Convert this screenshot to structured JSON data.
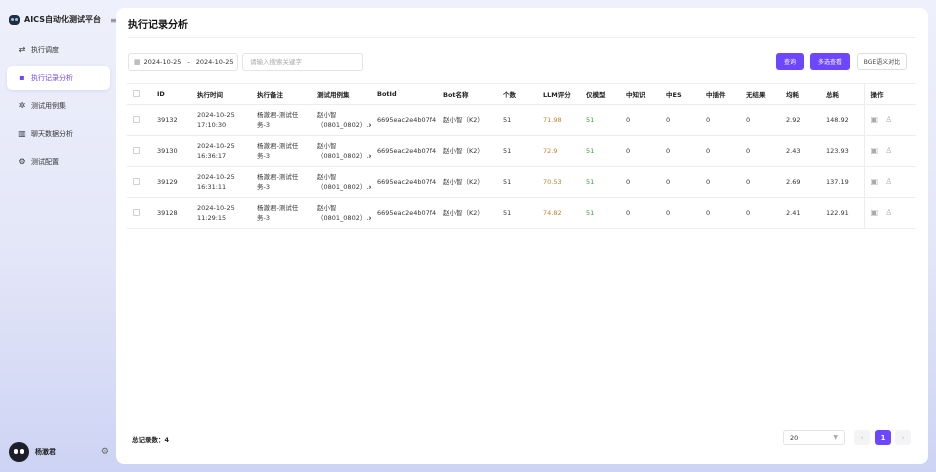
{
  "app": {
    "name": "AICS自动化测试平台"
  },
  "sidebar": {
    "items": [
      {
        "label": "执行调度",
        "icon": "swap-icon",
        "active": false
      },
      {
        "label": "执行记录分析",
        "icon": "chat-icon",
        "active": true
      },
      {
        "label": "测试用例集",
        "icon": "gear-icon",
        "active": false
      },
      {
        "label": "聊天数据分析",
        "icon": "bar-chart-icon",
        "active": false
      },
      {
        "label": "测试配置",
        "icon": "settings-icon",
        "active": false
      }
    ],
    "user": {
      "name": "杨澈君"
    }
  },
  "page": {
    "title": "执行记录分析"
  },
  "filters": {
    "date_start": "2024-10-25",
    "date_sep": "-",
    "date_end": "2024-10-25",
    "search_placeholder": "请输入搜索关键字"
  },
  "toolbar": {
    "query_label": "查询",
    "multi_label": "多选查看",
    "bge_label": "BGE语义对比"
  },
  "table": {
    "columns": [
      "ID",
      "执行时间",
      "执行备注",
      "测试用例集",
      "BotId",
      "Bot名称",
      "个数",
      "LLM评分",
      "仅模型",
      "中知识",
      "中ES",
      "中插件",
      "无结果",
      "均耗",
      "总耗",
      "操作"
    ],
    "rows": [
      {
        "id": "39132",
        "time1": "2024-10-25",
        "time2": "17:10:30",
        "note1": "杨澈君-测试任",
        "note2": "务-3",
        "case1": "赵小智",
        "case2": "（0801_0802）.xl",
        "botid": "6695eac2e4b07f41.",
        "botname": "赵小智（K2）",
        "count": "51",
        "llm": "71.98",
        "model": "51",
        "kb": "0",
        "es": "0",
        "plugin": "0",
        "none": "0",
        "avg": "2.92",
        "total": "148.92"
      },
      {
        "id": "39130",
        "time1": "2024-10-25",
        "time2": "16:36:17",
        "note1": "杨澈君-测试任",
        "note2": "务-3",
        "case1": "赵小智",
        "case2": "（0801_0802）.xl",
        "botid": "6695eac2e4b07f41.",
        "botname": "赵小智（K2）",
        "count": "51",
        "llm": "72.9",
        "model": "51",
        "kb": "0",
        "es": "0",
        "plugin": "0",
        "none": "0",
        "avg": "2.43",
        "total": "123.93"
      },
      {
        "id": "39129",
        "time1": "2024-10-25",
        "time2": "16:31:11",
        "note1": "杨澈君-测试任",
        "note2": "务-3",
        "case1": "赵小智",
        "case2": "（0801_0802）.xl",
        "botid": "6695eac2e4b07f41.",
        "botname": "赵小智（K2）",
        "count": "51",
        "llm": "70.53",
        "model": "51",
        "kb": "0",
        "es": "0",
        "plugin": "0",
        "none": "0",
        "avg": "2.69",
        "total": "137.19"
      },
      {
        "id": "39128",
        "time1": "2024-10-25",
        "time2": "11:29:15",
        "note1": "杨澈君-测试任",
        "note2": "务-3",
        "case1": "赵小智",
        "case2": "（0801_0802）.xl",
        "botid": "6695eac2e4b07f41.",
        "botname": "赵小智（K2）",
        "count": "51",
        "llm": "74.82",
        "model": "51",
        "kb": "0",
        "es": "0",
        "plugin": "0",
        "none": "0",
        "avg": "2.41",
        "total": "122.91"
      }
    ]
  },
  "footer": {
    "total_label": "总记录数：4",
    "page_size": "20",
    "current_page": "1"
  },
  "colors": {
    "accent": "#6c47ff",
    "llm_score": "#c0832b",
    "model_only": "#3a9a3a"
  }
}
